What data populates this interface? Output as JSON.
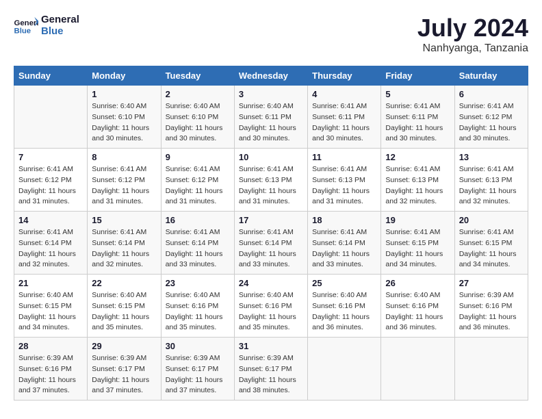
{
  "header": {
    "logo_line1": "General",
    "logo_line2": "Blue",
    "month_year": "July 2024",
    "location": "Nanhyanga, Tanzania"
  },
  "days_of_week": [
    "Sunday",
    "Monday",
    "Tuesday",
    "Wednesday",
    "Thursday",
    "Friday",
    "Saturday"
  ],
  "weeks": [
    [
      {
        "day": "",
        "sunrise": "",
        "sunset": "",
        "daylight": ""
      },
      {
        "day": "1",
        "sunrise": "Sunrise: 6:40 AM",
        "sunset": "Sunset: 6:10 PM",
        "daylight": "Daylight: 11 hours and 30 minutes."
      },
      {
        "day": "2",
        "sunrise": "Sunrise: 6:40 AM",
        "sunset": "Sunset: 6:10 PM",
        "daylight": "Daylight: 11 hours and 30 minutes."
      },
      {
        "day": "3",
        "sunrise": "Sunrise: 6:40 AM",
        "sunset": "Sunset: 6:11 PM",
        "daylight": "Daylight: 11 hours and 30 minutes."
      },
      {
        "day": "4",
        "sunrise": "Sunrise: 6:41 AM",
        "sunset": "Sunset: 6:11 PM",
        "daylight": "Daylight: 11 hours and 30 minutes."
      },
      {
        "day": "5",
        "sunrise": "Sunrise: 6:41 AM",
        "sunset": "Sunset: 6:11 PM",
        "daylight": "Daylight: 11 hours and 30 minutes."
      },
      {
        "day": "6",
        "sunrise": "Sunrise: 6:41 AM",
        "sunset": "Sunset: 6:12 PM",
        "daylight": "Daylight: 11 hours and 30 minutes."
      }
    ],
    [
      {
        "day": "7",
        "sunrise": "Sunrise: 6:41 AM",
        "sunset": "Sunset: 6:12 PM",
        "daylight": "Daylight: 11 hours and 31 minutes."
      },
      {
        "day": "8",
        "sunrise": "Sunrise: 6:41 AM",
        "sunset": "Sunset: 6:12 PM",
        "daylight": "Daylight: 11 hours and 31 minutes."
      },
      {
        "day": "9",
        "sunrise": "Sunrise: 6:41 AM",
        "sunset": "Sunset: 6:12 PM",
        "daylight": "Daylight: 11 hours and 31 minutes."
      },
      {
        "day": "10",
        "sunrise": "Sunrise: 6:41 AM",
        "sunset": "Sunset: 6:13 PM",
        "daylight": "Daylight: 11 hours and 31 minutes."
      },
      {
        "day": "11",
        "sunrise": "Sunrise: 6:41 AM",
        "sunset": "Sunset: 6:13 PM",
        "daylight": "Daylight: 11 hours and 31 minutes."
      },
      {
        "day": "12",
        "sunrise": "Sunrise: 6:41 AM",
        "sunset": "Sunset: 6:13 PM",
        "daylight": "Daylight: 11 hours and 32 minutes."
      },
      {
        "day": "13",
        "sunrise": "Sunrise: 6:41 AM",
        "sunset": "Sunset: 6:13 PM",
        "daylight": "Daylight: 11 hours and 32 minutes."
      }
    ],
    [
      {
        "day": "14",
        "sunrise": "Sunrise: 6:41 AM",
        "sunset": "Sunset: 6:14 PM",
        "daylight": "Daylight: 11 hours and 32 minutes."
      },
      {
        "day": "15",
        "sunrise": "Sunrise: 6:41 AM",
        "sunset": "Sunset: 6:14 PM",
        "daylight": "Daylight: 11 hours and 32 minutes."
      },
      {
        "day": "16",
        "sunrise": "Sunrise: 6:41 AM",
        "sunset": "Sunset: 6:14 PM",
        "daylight": "Daylight: 11 hours and 33 minutes."
      },
      {
        "day": "17",
        "sunrise": "Sunrise: 6:41 AM",
        "sunset": "Sunset: 6:14 PM",
        "daylight": "Daylight: 11 hours and 33 minutes."
      },
      {
        "day": "18",
        "sunrise": "Sunrise: 6:41 AM",
        "sunset": "Sunset: 6:14 PM",
        "daylight": "Daylight: 11 hours and 33 minutes."
      },
      {
        "day": "19",
        "sunrise": "Sunrise: 6:41 AM",
        "sunset": "Sunset: 6:15 PM",
        "daylight": "Daylight: 11 hours and 34 minutes."
      },
      {
        "day": "20",
        "sunrise": "Sunrise: 6:41 AM",
        "sunset": "Sunset: 6:15 PM",
        "daylight": "Daylight: 11 hours and 34 minutes."
      }
    ],
    [
      {
        "day": "21",
        "sunrise": "Sunrise: 6:40 AM",
        "sunset": "Sunset: 6:15 PM",
        "daylight": "Daylight: 11 hours and 34 minutes."
      },
      {
        "day": "22",
        "sunrise": "Sunrise: 6:40 AM",
        "sunset": "Sunset: 6:15 PM",
        "daylight": "Daylight: 11 hours and 35 minutes."
      },
      {
        "day": "23",
        "sunrise": "Sunrise: 6:40 AM",
        "sunset": "Sunset: 6:16 PM",
        "daylight": "Daylight: 11 hours and 35 minutes."
      },
      {
        "day": "24",
        "sunrise": "Sunrise: 6:40 AM",
        "sunset": "Sunset: 6:16 PM",
        "daylight": "Daylight: 11 hours and 35 minutes."
      },
      {
        "day": "25",
        "sunrise": "Sunrise: 6:40 AM",
        "sunset": "Sunset: 6:16 PM",
        "daylight": "Daylight: 11 hours and 36 minutes."
      },
      {
        "day": "26",
        "sunrise": "Sunrise: 6:40 AM",
        "sunset": "Sunset: 6:16 PM",
        "daylight": "Daylight: 11 hours and 36 minutes."
      },
      {
        "day": "27",
        "sunrise": "Sunrise: 6:39 AM",
        "sunset": "Sunset: 6:16 PM",
        "daylight": "Daylight: 11 hours and 36 minutes."
      }
    ],
    [
      {
        "day": "28",
        "sunrise": "Sunrise: 6:39 AM",
        "sunset": "Sunset: 6:16 PM",
        "daylight": "Daylight: 11 hours and 37 minutes."
      },
      {
        "day": "29",
        "sunrise": "Sunrise: 6:39 AM",
        "sunset": "Sunset: 6:17 PM",
        "daylight": "Daylight: 11 hours and 37 minutes."
      },
      {
        "day": "30",
        "sunrise": "Sunrise: 6:39 AM",
        "sunset": "Sunset: 6:17 PM",
        "daylight": "Daylight: 11 hours and 37 minutes."
      },
      {
        "day": "31",
        "sunrise": "Sunrise: 6:39 AM",
        "sunset": "Sunset: 6:17 PM",
        "daylight": "Daylight: 11 hours and 38 minutes."
      },
      {
        "day": "",
        "sunrise": "",
        "sunset": "",
        "daylight": ""
      },
      {
        "day": "",
        "sunrise": "",
        "sunset": "",
        "daylight": ""
      },
      {
        "day": "",
        "sunrise": "",
        "sunset": "",
        "daylight": ""
      }
    ]
  ]
}
